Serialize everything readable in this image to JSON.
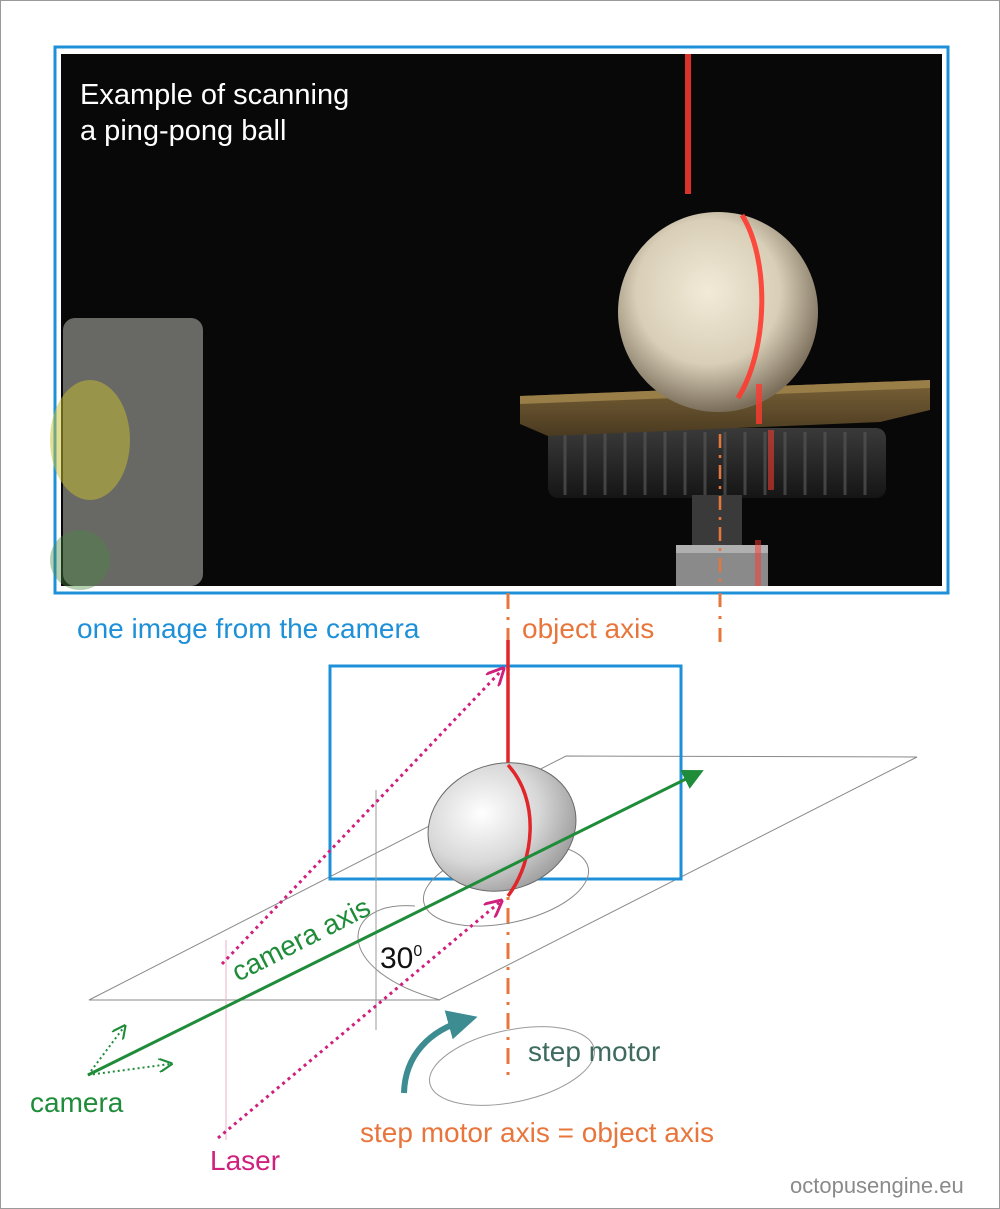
{
  "photo": {
    "caption_line1": "Example of scanning",
    "caption_line2": "a ping-pong ball"
  },
  "labels": {
    "camera_image": "one image from the camera",
    "object_axis": "object axis",
    "camera_axis": "camera axis",
    "angle_value": "30",
    "angle_unit": "0",
    "step_motor": "step motor",
    "camera": "camera",
    "step_motor_axis": "step motor axis = object axis",
    "laser": "Laser",
    "watermark": "octopusengine.eu"
  },
  "colors": {
    "frame_blue": "#1e90d8",
    "axis_orange": "#e8763c",
    "camera_green": "#1f8c3a",
    "laser_magenta": "#d0207d",
    "laser_red": "#e0262a",
    "motor_teal": "#3d8c92",
    "motor_label": "#3e6b5e",
    "watermark_gray": "#8a8a8a"
  }
}
